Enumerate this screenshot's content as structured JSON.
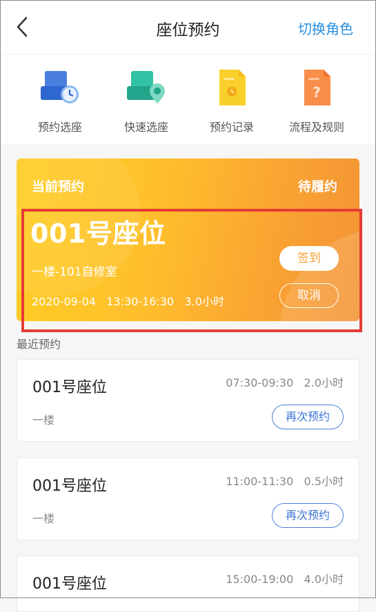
{
  "header": {
    "title": "座位预约",
    "switch_role": "切换角色"
  },
  "actions": [
    {
      "label": "预约选座",
      "icon": "seat-clock-icon"
    },
    {
      "label": "快速选座",
      "icon": "seat-location-icon"
    },
    {
      "label": "预约记录",
      "icon": "record-document-icon"
    },
    {
      "label": "流程及规则",
      "icon": "rules-document-icon"
    }
  ],
  "current": {
    "label": "当前预约",
    "status": "待履约",
    "seat": "001号座位",
    "room": "一楼-101自修室",
    "datetime": "2020-09-04   13:30-16:30   3.0小时",
    "checkin": "签到",
    "cancel": "取消"
  },
  "recent_title": "最近预约",
  "recent": [
    {
      "seat": "001号座位",
      "time": "07:30-09:30   2.0小时",
      "floor": "一楼",
      "action": "再次预约"
    },
    {
      "seat": "001号座位",
      "time": "11:00-11:30   0.5小时",
      "floor": "一楼",
      "action": "再次预约"
    },
    {
      "seat": "001号座位",
      "time": "15:00-19:00   4.0小时",
      "floor": "",
      "action": ""
    }
  ],
  "colors": {
    "accent": "#2a8fe0",
    "card_start": "#ffce24",
    "card_end": "#f39334",
    "rebook": "#3a72d4",
    "highlight": "#e53c33"
  }
}
